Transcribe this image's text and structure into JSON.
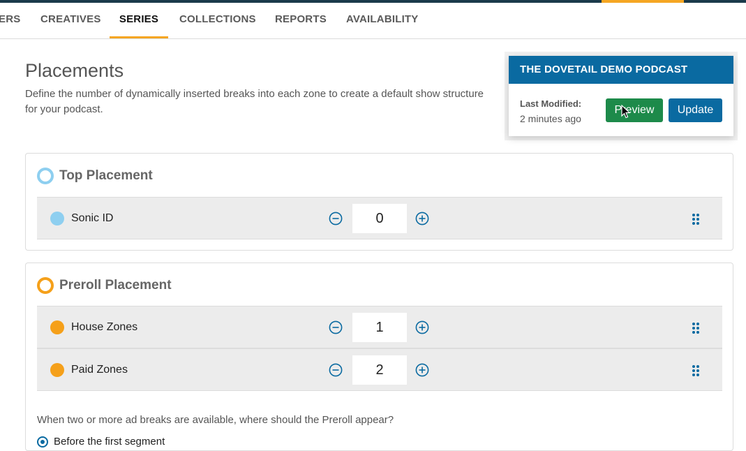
{
  "nav": {
    "tabs": [
      {
        "label": "ERS"
      },
      {
        "label": "CREATIVES"
      },
      {
        "label": "SERIES"
      },
      {
        "label": "COLLECTIONS"
      },
      {
        "label": "REPORTS"
      },
      {
        "label": "AVAILABILITY"
      }
    ],
    "active_tab": "SERIES"
  },
  "page": {
    "title": "Placements",
    "description": "Define the number of dynamically inserted breaks into each zone to create a default show structure for your podcast."
  },
  "podcast_card": {
    "name": "THE DOVETAIL DEMO PODCAST",
    "last_modified_label": "Last Modified:",
    "last_modified_value": "2 minutes ago",
    "preview_label": "Preview",
    "update_label": "Update"
  },
  "top_placement": {
    "title": "Top Placement",
    "color": "#8ecff0",
    "zones": [
      {
        "label": "Sonic ID",
        "count": "0",
        "color": "#8ecff0"
      }
    ]
  },
  "preroll_placement": {
    "title": "Preroll Placement",
    "color": "#f5a01a",
    "zones": [
      {
        "label": "House Zones",
        "count": "1",
        "color": "#f5a01a"
      },
      {
        "label": "Paid Zones",
        "count": "2",
        "color": "#f5a01a"
      }
    ],
    "question": "When two or more ad breaks are available, where should the Preroll appear?",
    "options": [
      {
        "label": "Before the first segment",
        "selected": true
      }
    ]
  },
  "colors": {
    "accent": "#f5a623",
    "primary": "#0a6aa1",
    "success": "#1d8a4a"
  }
}
